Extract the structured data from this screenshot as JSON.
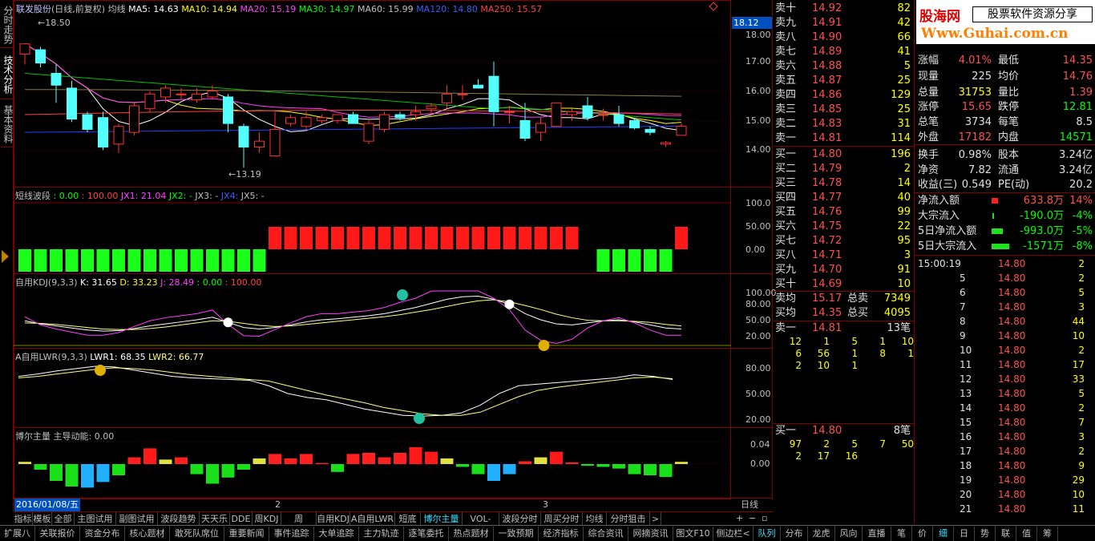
{
  "left_tabs": [
    "分时走势",
    "技术分析",
    "基本资料"
  ],
  "header": {
    "stock": "联发股份",
    "mode": "(日线,前复权)",
    "ma_label": "均线",
    "ma5": "MA5: 14.63",
    "ma10": "MA10: 14.94",
    "ma20": "MA20: 15.19",
    "ma30": "MA30: 14.97",
    "ma60": "MA60: 15.99",
    "ma120": "MA120: 14.80",
    "ma250": "MA250: 15.57"
  },
  "main_axis": {
    "price_tag": "18.12",
    "ticks": [
      "18.00",
      "17.00",
      "16.00",
      "15.00",
      "14.00"
    ]
  },
  "annotations": {
    "high": "18.50",
    "low": "13.19"
  },
  "candles": [
    {
      "o": 17.25,
      "h": 17.6,
      "l": 16.9,
      "c": 17.6
    },
    {
      "o": 17.4,
      "h": 17.5,
      "l": 16.8,
      "c": 16.95
    },
    {
      "o": 16.6,
      "h": 16.9,
      "l": 15.6,
      "c": 16.2
    },
    {
      "o": 16.1,
      "h": 16.35,
      "l": 14.95,
      "c": 15.05
    },
    {
      "o": 15.2,
      "h": 15.3,
      "l": 14.6,
      "c": 14.7
    },
    {
      "o": 15.1,
      "h": 15.3,
      "l": 14.0,
      "c": 14.1
    },
    {
      "o": 14.2,
      "h": 14.9,
      "l": 13.9,
      "c": 14.8
    },
    {
      "o": 14.6,
      "h": 15.6,
      "l": 14.5,
      "c": 15.5
    },
    {
      "o": 15.4,
      "h": 16.0,
      "l": 15.3,
      "c": 15.9
    },
    {
      "o": 15.8,
      "h": 16.2,
      "l": 15.6,
      "c": 16.1
    },
    {
      "o": 15.9,
      "h": 16.1,
      "l": 15.7,
      "c": 15.9
    },
    {
      "o": 15.7,
      "h": 16.1,
      "l": 15.6,
      "c": 15.9
    },
    {
      "o": 15.8,
      "h": 16.2,
      "l": 15.7,
      "c": 16.0
    },
    {
      "o": 15.8,
      "h": 15.9,
      "l": 14.6,
      "c": 14.9
    },
    {
      "o": 14.8,
      "h": 14.9,
      "l": 13.4,
      "c": 14.1
    },
    {
      "o": 14.1,
      "h": 14.6,
      "l": 13.9,
      "c": 14.3
    },
    {
      "o": 13.8,
      "h": 15.3,
      "l": 13.8,
      "c": 14.7
    },
    {
      "o": 14.9,
      "h": 15.2,
      "l": 14.8,
      "c": 15.1
    },
    {
      "o": 14.8,
      "h": 15.3,
      "l": 14.7,
      "c": 15.1
    },
    {
      "o": 15.0,
      "h": 15.2,
      "l": 14.9,
      "c": 15.1
    },
    {
      "o": 15.0,
      "h": 15.2,
      "l": 14.9,
      "c": 15.2
    },
    {
      "o": 15.2,
      "h": 15.3,
      "l": 14.9,
      "c": 14.9
    },
    {
      "o": 14.3,
      "h": 15.0,
      "l": 14.2,
      "c": 14.9
    },
    {
      "o": 14.7,
      "h": 15.3,
      "l": 14.6,
      "c": 15.2
    },
    {
      "o": 15.2,
      "h": 15.3,
      "l": 15.0,
      "c": 15.1
    },
    {
      "o": 15.2,
      "h": 15.5,
      "l": 15.0,
      "c": 15.3
    },
    {
      "o": 15.4,
      "h": 15.6,
      "l": 15.2,
      "c": 15.5
    },
    {
      "o": 15.6,
      "h": 16.2,
      "l": 15.4,
      "c": 15.9
    },
    {
      "o": 15.9,
      "h": 16.2,
      "l": 15.7,
      "c": 15.9
    },
    {
      "o": 16.2,
      "h": 16.4,
      "l": 16.1,
      "c": 16.1
    },
    {
      "o": 16.5,
      "h": 17.0,
      "l": 14.8,
      "c": 15.3
    },
    {
      "o": 15.3,
      "h": 15.5,
      "l": 14.9,
      "c": 15.3
    },
    {
      "o": 15.0,
      "h": 15.6,
      "l": 14.3,
      "c": 14.4
    },
    {
      "o": 14.6,
      "h": 15.1,
      "l": 14.3,
      "c": 14.9
    },
    {
      "o": 14.8,
      "h": 15.6,
      "l": 14.8,
      "c": 15.6
    },
    {
      "o": 15.2,
      "h": 15.4,
      "l": 15.0,
      "c": 15.3
    },
    {
      "o": 15.5,
      "h": 15.8,
      "l": 15.0,
      "c": 15.1
    },
    {
      "o": 15.2,
      "h": 15.4,
      "l": 15.0,
      "c": 15.2
    },
    {
      "o": 15.2,
      "h": 15.5,
      "l": 14.8,
      "c": 14.9
    },
    {
      "o": 15.0,
      "h": 15.1,
      "l": 14.7,
      "c": 14.75
    },
    {
      "o": 14.7,
      "h": 14.8,
      "l": 14.5,
      "c": 14.6
    },
    {
      "o": 14.2,
      "h": 14.3,
      "l": 14.1,
      "c": 14.25
    },
    {
      "o": 14.5,
      "h": 14.9,
      "l": 14.5,
      "c": 14.81
    }
  ],
  "wave": {
    "label": "短线波段",
    "v0": ": 0.00",
    "v1": ": 100.00",
    "jx1": "JX1: 21.04",
    "jx2": "JX2: -",
    "jx3": "JX3: -",
    "jx4": "JX4:",
    "jx5": "JX5: -",
    "ticks": [
      "100.0",
      "50.00",
      "0.00"
    ],
    "bars": [
      -1,
      -1,
      -1,
      -1,
      -1,
      -1,
      -1,
      -1,
      -1,
      -1,
      -1,
      -1,
      -1,
      -1,
      -1,
      -1,
      1,
      1,
      1,
      1,
      1,
      1,
      1,
      1,
      1,
      1,
      1,
      1,
      1,
      1,
      1,
      1,
      1,
      1,
      1,
      1,
      0,
      -1,
      -1,
      -1,
      -1,
      -1,
      1
    ]
  },
  "kdj": {
    "label": "自用KDJ(9,3,3)",
    "k": "K: 31.65",
    "d": "D: 33.23",
    "j": "J: 28.49",
    "v0": ": 0.00",
    "v1": ": 100.00",
    "ticks": [
      "100.00",
      "80.00",
      "50.00",
      "20.00"
    ],
    "k_values": [
      48,
      42,
      38,
      34,
      30,
      28,
      29,
      33,
      38,
      42,
      46,
      50,
      55,
      45,
      35,
      32,
      35,
      40,
      46,
      50,
      52,
      55,
      58,
      62,
      68,
      74,
      82,
      90,
      95,
      96,
      90,
      80,
      62,
      50,
      42,
      40,
      44,
      48,
      50,
      46,
      40,
      34,
      32
    ],
    "d_values": [
      44,
      43,
      41,
      38,
      35,
      32,
      31,
      31,
      33,
      36,
      40,
      44,
      48,
      47,
      43,
      39,
      37,
      38,
      41,
      44,
      47,
      50,
      53,
      56,
      60,
      65,
      70,
      76,
      82,
      87,
      89,
      85,
      78,
      70,
      61,
      54,
      49,
      48,
      48,
      47,
      45,
      41,
      38
    ],
    "j_values": [
      56,
      40,
      32,
      26,
      20,
      20,
      25,
      37,
      48,
      54,
      58,
      62,
      69,
      41,
      19,
      18,
      31,
      44,
      56,
      62,
      62,
      65,
      68,
      74,
      84,
      92,
      106,
      118,
      121,
      114,
      92,
      70,
      30,
      10,
      4,
      12,
      34,
      48,
      54,
      44,
      30,
      20,
      20
    ]
  },
  "lwr": {
    "label": "A自用LWR(9,3,3)",
    "lwr1": "LWR1: 68.35",
    "lwr2": "LWR2: 66.77",
    "ticks": [
      "80.00",
      "50.00",
      "20.00"
    ],
    "lwr1_values": [
      72,
      75,
      79,
      82,
      85,
      84,
      80,
      76,
      72,
      70,
      69,
      68,
      67,
      60,
      50,
      45,
      42,
      36,
      30,
      26,
      22,
      21,
      22,
      25,
      35,
      50,
      60,
      62,
      64,
      66,
      68,
      70,
      74,
      72,
      68
    ],
    "lwr2_values": [
      70,
      72,
      75,
      78,
      81,
      83,
      82,
      80,
      77,
      74,
      72,
      70,
      68,
      66,
      60,
      54,
      48,
      43,
      38,
      32,
      28,
      24,
      22,
      22,
      26,
      36,
      46,
      54,
      58,
      61,
      64,
      67,
      70,
      71,
      69
    ]
  },
  "bor": {
    "label": "博尔主量",
    "sub": "主导动能: 0.00",
    "ticks": [
      "0.04",
      "0.00"
    ],
    "bars": [
      0.004,
      -0.01,
      -0.03,
      -0.04,
      -0.042,
      -0.032,
      -0.02,
      0.012,
      0.028,
      0.008,
      0.012,
      -0.018,
      -0.035,
      -0.024,
      -0.01,
      0.01,
      0.018,
      0.01,
      0.018,
      0.002,
      -0.014,
      0.018,
      0.02,
      0.012,
      0.02,
      0.03,
      0.022,
      0.01,
      -0.005,
      -0.018,
      -0.03,
      -0.018,
      0.005,
      0.012,
      0.022,
      0.003,
      -0.003,
      -0.005,
      -0.008,
      -0.018,
      -0.02,
      -0.023,
      0.004
    ]
  },
  "date_bar": {
    "date": "2016/01/08/五",
    "m2": "2",
    "m3": "3",
    "period": "日线"
  },
  "buttons": [
    "指标",
    "模板",
    "全部",
    "主图试用",
    "副图试用",
    "波段趋势",
    "天天乐",
    "DDE",
    "周KDJ",
    "周MACD",
    "自用KDJ",
    "A自用LWR",
    "短底",
    "博尔主量",
    "VOL-TDX",
    "波段分时",
    "周买分时",
    "均线",
    "分时狙击"
  ],
  "status": [
    "扩展八",
    "关联报价",
    "资金分布",
    "核心题材",
    "敢死队席位",
    "重要新闻",
    "事件追踪",
    "大单追踪",
    "主力轨迹",
    "逐笔委托",
    "热点题材",
    "一致预期",
    "经济指标",
    "综合资讯",
    "网摘资讯",
    "图文F10",
    "侧边栏<",
    "队列",
    "分布",
    "龙虎",
    "风向",
    "直播",
    "笔",
    "价",
    "细",
    "日",
    "势",
    "联",
    "值",
    "筹"
  ],
  "sells": [
    [
      "卖十",
      "14.92",
      "82"
    ],
    [
      "卖九",
      "14.91",
      "42"
    ],
    [
      "卖八",
      "14.90",
      "66"
    ],
    [
      "卖七",
      "14.89",
      "41"
    ],
    [
      "卖六",
      "14.88",
      "5"
    ],
    [
      "卖五",
      "14.87",
      "25"
    ],
    [
      "卖四",
      "14.86",
      "129"
    ],
    [
      "卖三",
      "14.85",
      "25"
    ],
    [
      "卖二",
      "14.83",
      "31"
    ],
    [
      "卖一",
      "14.81",
      "114"
    ]
  ],
  "buys": [
    [
      "买一",
      "14.80",
      "196"
    ],
    [
      "买二",
      "14.79",
      "2"
    ],
    [
      "买三",
      "14.78",
      "14"
    ],
    [
      "买四",
      "14.77",
      "40"
    ],
    [
      "买五",
      "14.76",
      "99"
    ],
    [
      "买六",
      "14.75",
      "22"
    ],
    [
      "买七",
      "14.72",
      "95"
    ],
    [
      "买八",
      "14.71",
      "3"
    ],
    [
      "买九",
      "14.70",
      "91"
    ],
    [
      "买十",
      "14.69",
      "10"
    ]
  ],
  "avg": {
    "sell_avg_l": "卖均",
    "sell_avg": "15.17",
    "total_sell_l": "总卖",
    "total_sell": "7349",
    "buy_avg_l": "买均",
    "buy_avg": "14.35",
    "total_buy_l": "总买",
    "total_buy": "4095"
  },
  "queue_sell": {
    "label": "卖一",
    "price": "14.81",
    "count": "13笔",
    "rows": [
      [
        "12",
        "1",
        "5",
        "1",
        "10"
      ],
      [
        "6",
        "56",
        "1",
        "8",
        "1"
      ],
      [
        "2",
        "10",
        "1",
        "",
        ""
      ]
    ]
  },
  "queue_buy": {
    "label": "买一",
    "price": "14.80",
    "count": "8笔",
    "rows": [
      [
        "97",
        "2",
        "5",
        "7",
        "50"
      ],
      [
        "2",
        "17",
        "16",
        "",
        ""
      ]
    ]
  },
  "logo": {
    "name": "股海网",
    "slogan": "股票软件资源分享",
    "url": "Www.Guhai.com.cn"
  },
  "info": [
    [
      "涨幅",
      "4.01%",
      "最低",
      "14.35"
    ],
    [
      "现量",
      "225",
      "均价",
      "14.76"
    ],
    [
      "总量",
      "31753",
      "量比",
      "1.39"
    ],
    [
      "涨停",
      "15.65",
      "跌停",
      "12.81"
    ],
    [
      "总笔",
      "3734",
      "每笔",
      "8.5"
    ],
    [
      "外盘",
      "17182",
      "内盘",
      "14571"
    ],
    [
      "换手",
      "0.98%",
      "股本",
      "3.24亿"
    ],
    [
      "净资",
      "7.82",
      "流通",
      "3.24亿"
    ],
    [
      "收益(三)",
      "0.549",
      "PE(动)",
      "20.2"
    ]
  ],
  "flows": [
    [
      "净流入额",
      "633.8万",
      "14%"
    ],
    [
      "大宗流入",
      "-190.0万",
      "-4%"
    ],
    [
      "5日净流入额",
      "-993.0万",
      "-5%"
    ],
    [
      "5日大宗流入",
      "-1571万",
      "-8%"
    ]
  ],
  "ticks": [
    [
      "15:00:19",
      "14.80",
      "2"
    ],
    [
      "5",
      "14.80",
      "2"
    ],
    [
      "6",
      "14.80",
      "5"
    ],
    [
      "7",
      "14.80",
      "3"
    ],
    [
      "8",
      "14.80",
      "44"
    ],
    [
      "9",
      "14.80",
      "10"
    ],
    [
      "10",
      "14.80",
      "2"
    ],
    [
      "11",
      "14.80",
      "17"
    ],
    [
      "12",
      "14.80",
      "33"
    ],
    [
      "13",
      "14.80",
      "5"
    ],
    [
      "14",
      "14.80",
      "2"
    ],
    [
      "15",
      "14.80",
      "7"
    ],
    [
      "16",
      "14.80",
      "3"
    ],
    [
      "17",
      "14.80",
      "2"
    ],
    [
      "18",
      "14.80",
      "9"
    ],
    [
      "19",
      "14.80",
      "29"
    ],
    [
      "20",
      "14.80",
      "10"
    ],
    [
      "21",
      "14.80",
      "11"
    ]
  ]
}
